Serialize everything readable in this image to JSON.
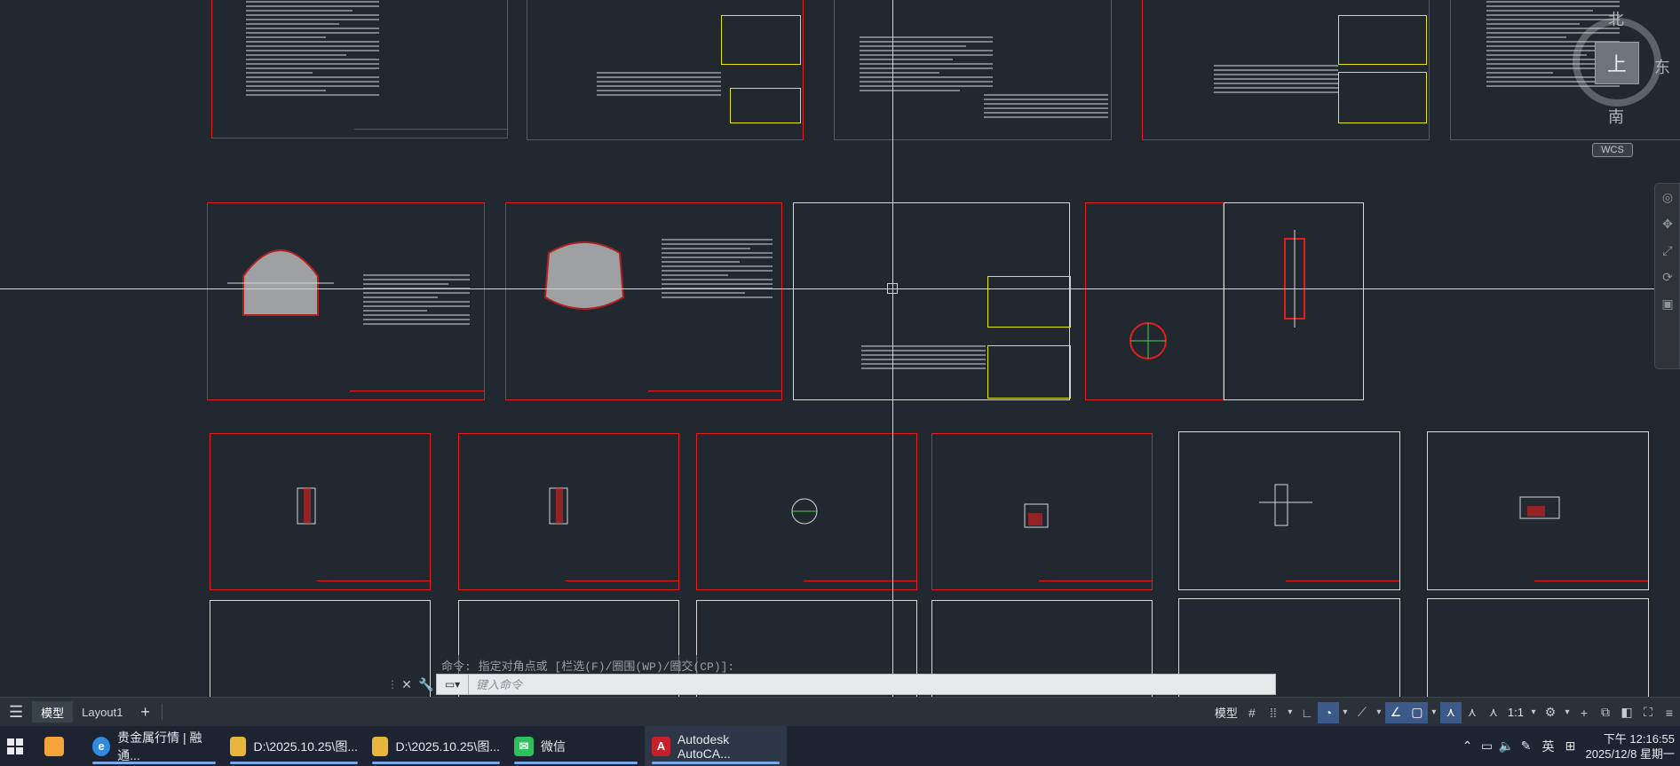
{
  "viewcube": {
    "north": "北",
    "east": "东",
    "south": "南",
    "top_face": "上",
    "wcs": "WCS"
  },
  "command": {
    "history": "命令: 指定对角点或 [栏选(F)/圈围(WP)/圈交(CP)]:",
    "placeholder": "键入命令"
  },
  "layout_tabs": {
    "model": "模型",
    "layout1": "Layout1",
    "add": "+"
  },
  "statusbar": {
    "model_label": "模型",
    "scale": "1:1"
  },
  "taskbar": {
    "apps": [
      {
        "name": "start",
        "label": ""
      },
      {
        "name": "store",
        "label": ""
      },
      {
        "name": "browser",
        "label": "贵金属行情 | 融通..."
      },
      {
        "name": "explorer-1",
        "label": "D:\\2025.10.25\\图..."
      },
      {
        "name": "explorer-2",
        "label": "D:\\2025.10.25\\图..."
      },
      {
        "name": "wechat",
        "label": "微信"
      },
      {
        "name": "autocad",
        "label": "Autodesk AutoCA..."
      }
    ],
    "ime": "英",
    "time": "下午 12:16:55",
    "date": "2025/12/8 星期一"
  },
  "colors": {
    "canvas": "#212830",
    "sheet_red": "#e0201c",
    "sheet_white": "#d8d8d8",
    "yellow": "#e6e60a",
    "taskbar": "#1d2330"
  }
}
